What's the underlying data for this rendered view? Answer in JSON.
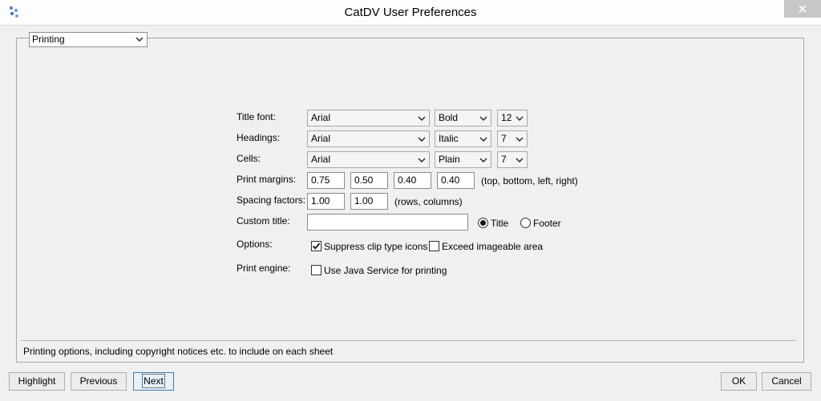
{
  "window": {
    "title": "CatDV User Preferences"
  },
  "section_select": {
    "value": "Printing"
  },
  "form": {
    "title_font": {
      "label": "Title font:",
      "font": "Arial",
      "style": "Bold",
      "size": "12"
    },
    "headings": {
      "label": "Headings:",
      "font": "Arial",
      "style": "Italic",
      "size": "7"
    },
    "cells": {
      "label": "Cells:",
      "font": "Arial",
      "style": "Plain",
      "size": "7"
    },
    "print_margins": {
      "label": "Print margins:",
      "top": "0.75",
      "bottom": "0.50",
      "left": "0.40",
      "right": "0.40",
      "hint": "(top, bottom, left, right)"
    },
    "spacing_factors": {
      "label": "Spacing factors:",
      "rows": "1.00",
      "columns": "1.00",
      "hint": "(rows, columns)"
    },
    "custom_title": {
      "label": "Custom title:",
      "value": "",
      "title_option": "Title",
      "footer_option": "Footer",
      "selected": "Title"
    },
    "options": {
      "label": "Options:",
      "suppress_clip": "Suppress clip type icons",
      "suppress_checked": true,
      "exceed_area": "Exceed imageable area",
      "exceed_checked": false
    },
    "print_engine": {
      "label": "Print engine:",
      "java_service": "Use Java Service for printing",
      "java_checked": false
    }
  },
  "status_text": "Printing options, including copyright notices etc. to include on each sheet",
  "buttons": {
    "highlight": "Highlight",
    "previous": "Previous",
    "next": "Next",
    "ok": "OK",
    "cancel": "Cancel"
  }
}
